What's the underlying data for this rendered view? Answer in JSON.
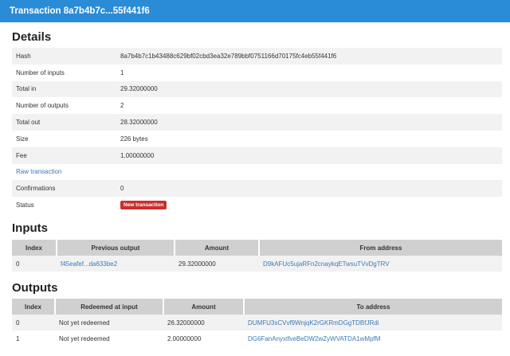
{
  "header": {
    "title": "Transaction 8a7b4b7c...55f441f6"
  },
  "details": {
    "heading": "Details",
    "rows": [
      {
        "label": "Hash",
        "value": "8a7b4b7c1b43488c629bf02cbd3ea32e789bbf0751166d70175fc4eb55f441f6"
      },
      {
        "label": "Number of inputs",
        "value": "1"
      },
      {
        "label": "Total in",
        "value": "29.32000000"
      },
      {
        "label": "Number of outputs",
        "value": "2"
      },
      {
        "label": "Total out",
        "value": "28.32000000"
      },
      {
        "label": "Size",
        "value": "226 bytes"
      },
      {
        "label": "Fee",
        "value": "1.00000000"
      },
      {
        "label": "Raw transaction",
        "value": ""
      },
      {
        "label": "Confirmations",
        "value": "0"
      },
      {
        "label": "Status",
        "badge": "New transaction"
      }
    ]
  },
  "inputs": {
    "heading": "Inputs",
    "columns": [
      "Index",
      "Previous output",
      "Amount",
      "From address"
    ],
    "rows": [
      {
        "index": "0",
        "previous_output": "f45eafef...da633be2",
        "amount": "29.32000000",
        "address": "D9kAFUc5ujaRFn2cnaykqETwsuTVvDgTRV"
      }
    ]
  },
  "outputs": {
    "heading": "Outputs",
    "columns": [
      "Index",
      "Redeemed at input",
      "Amount",
      "To address"
    ],
    "rows": [
      {
        "index": "0",
        "redeemed": "Not yet redeemed",
        "amount": "26.32000000",
        "address": "DUMFU3sCVvf9WnjqK2rGKRmDGgTDBfJRdi"
      },
      {
        "index": "1",
        "redeemed": "Not yet redeemed",
        "amount": "2.00000000",
        "address": "DG6FanAnyxtfveBeDW2wZyWVATDA1wMpfM"
      }
    ]
  },
  "colors": {
    "header_bg": "#2a8bd6",
    "link": "#3a7ab8",
    "badge_bg": "#c9302c",
    "row_stripe": "#f2f2f2",
    "table_header": "#d0d0d0"
  }
}
